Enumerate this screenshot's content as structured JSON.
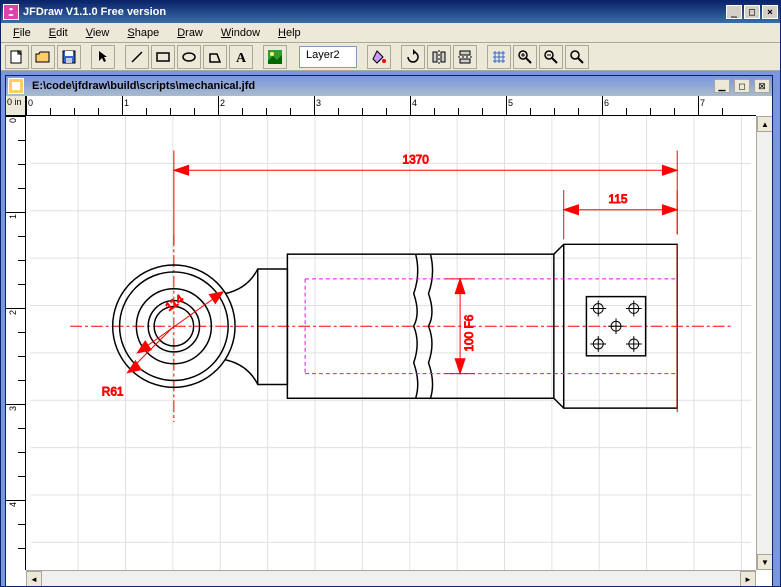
{
  "window": {
    "title": "JFDraw V1.1.0 Free version",
    "min": "_",
    "max": "□",
    "close": "×"
  },
  "menus": {
    "file": "File",
    "edit": "Edit",
    "view": "View",
    "shape": "Shape",
    "draw": "Draw",
    "window": "Window",
    "help": "Help"
  },
  "toolbar": {
    "layer": "Layer2"
  },
  "doc": {
    "path": "E:\\code\\jfdraw\\build\\scripts\\mechanical.jfd",
    "units": "0 in"
  },
  "ruler_h": [
    "0",
    "1",
    "2",
    "3",
    "4",
    "5",
    "6",
    "7"
  ],
  "ruler_v": [
    "0",
    "1",
    "2",
    "3",
    "4"
  ],
  "dims": {
    "d1370": "1370",
    "d115": "115",
    "d114": "114",
    "r61": "R61",
    "d100f6": "100 F6"
  }
}
